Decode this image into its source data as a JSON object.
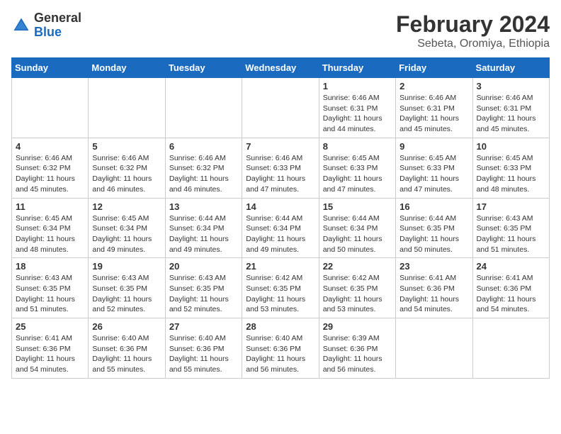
{
  "header": {
    "logo_general": "General",
    "logo_blue": "Blue",
    "month_year": "February 2024",
    "location": "Sebeta, Oromiya, Ethiopia"
  },
  "calendar": {
    "days_of_week": [
      "Sunday",
      "Monday",
      "Tuesday",
      "Wednesday",
      "Thursday",
      "Friday",
      "Saturday"
    ],
    "weeks": [
      [
        {
          "day": "",
          "info": ""
        },
        {
          "day": "",
          "info": ""
        },
        {
          "day": "",
          "info": ""
        },
        {
          "day": "",
          "info": ""
        },
        {
          "day": "1",
          "info": "Sunrise: 6:46 AM\nSunset: 6:31 PM\nDaylight: 11 hours and 44 minutes."
        },
        {
          "day": "2",
          "info": "Sunrise: 6:46 AM\nSunset: 6:31 PM\nDaylight: 11 hours and 45 minutes."
        },
        {
          "day": "3",
          "info": "Sunrise: 6:46 AM\nSunset: 6:31 PM\nDaylight: 11 hours and 45 minutes."
        }
      ],
      [
        {
          "day": "4",
          "info": "Sunrise: 6:46 AM\nSunset: 6:32 PM\nDaylight: 11 hours and 45 minutes."
        },
        {
          "day": "5",
          "info": "Sunrise: 6:46 AM\nSunset: 6:32 PM\nDaylight: 11 hours and 46 minutes."
        },
        {
          "day": "6",
          "info": "Sunrise: 6:46 AM\nSunset: 6:32 PM\nDaylight: 11 hours and 46 minutes."
        },
        {
          "day": "7",
          "info": "Sunrise: 6:46 AM\nSunset: 6:33 PM\nDaylight: 11 hours and 47 minutes."
        },
        {
          "day": "8",
          "info": "Sunrise: 6:45 AM\nSunset: 6:33 PM\nDaylight: 11 hours and 47 minutes."
        },
        {
          "day": "9",
          "info": "Sunrise: 6:45 AM\nSunset: 6:33 PM\nDaylight: 11 hours and 47 minutes."
        },
        {
          "day": "10",
          "info": "Sunrise: 6:45 AM\nSunset: 6:33 PM\nDaylight: 11 hours and 48 minutes."
        }
      ],
      [
        {
          "day": "11",
          "info": "Sunrise: 6:45 AM\nSunset: 6:34 PM\nDaylight: 11 hours and 48 minutes."
        },
        {
          "day": "12",
          "info": "Sunrise: 6:45 AM\nSunset: 6:34 PM\nDaylight: 11 hours and 49 minutes."
        },
        {
          "day": "13",
          "info": "Sunrise: 6:44 AM\nSunset: 6:34 PM\nDaylight: 11 hours and 49 minutes."
        },
        {
          "day": "14",
          "info": "Sunrise: 6:44 AM\nSunset: 6:34 PM\nDaylight: 11 hours and 49 minutes."
        },
        {
          "day": "15",
          "info": "Sunrise: 6:44 AM\nSunset: 6:34 PM\nDaylight: 11 hours and 50 minutes."
        },
        {
          "day": "16",
          "info": "Sunrise: 6:44 AM\nSunset: 6:35 PM\nDaylight: 11 hours and 50 minutes."
        },
        {
          "day": "17",
          "info": "Sunrise: 6:43 AM\nSunset: 6:35 PM\nDaylight: 11 hours and 51 minutes."
        }
      ],
      [
        {
          "day": "18",
          "info": "Sunrise: 6:43 AM\nSunset: 6:35 PM\nDaylight: 11 hours and 51 minutes."
        },
        {
          "day": "19",
          "info": "Sunrise: 6:43 AM\nSunset: 6:35 PM\nDaylight: 11 hours and 52 minutes."
        },
        {
          "day": "20",
          "info": "Sunrise: 6:43 AM\nSunset: 6:35 PM\nDaylight: 11 hours and 52 minutes."
        },
        {
          "day": "21",
          "info": "Sunrise: 6:42 AM\nSunset: 6:35 PM\nDaylight: 11 hours and 53 minutes."
        },
        {
          "day": "22",
          "info": "Sunrise: 6:42 AM\nSunset: 6:35 PM\nDaylight: 11 hours and 53 minutes."
        },
        {
          "day": "23",
          "info": "Sunrise: 6:41 AM\nSunset: 6:36 PM\nDaylight: 11 hours and 54 minutes."
        },
        {
          "day": "24",
          "info": "Sunrise: 6:41 AM\nSunset: 6:36 PM\nDaylight: 11 hours and 54 minutes."
        }
      ],
      [
        {
          "day": "25",
          "info": "Sunrise: 6:41 AM\nSunset: 6:36 PM\nDaylight: 11 hours and 54 minutes."
        },
        {
          "day": "26",
          "info": "Sunrise: 6:40 AM\nSunset: 6:36 PM\nDaylight: 11 hours and 55 minutes."
        },
        {
          "day": "27",
          "info": "Sunrise: 6:40 AM\nSunset: 6:36 PM\nDaylight: 11 hours and 55 minutes."
        },
        {
          "day": "28",
          "info": "Sunrise: 6:40 AM\nSunset: 6:36 PM\nDaylight: 11 hours and 56 minutes."
        },
        {
          "day": "29",
          "info": "Sunrise: 6:39 AM\nSunset: 6:36 PM\nDaylight: 11 hours and 56 minutes."
        },
        {
          "day": "",
          "info": ""
        },
        {
          "day": "",
          "info": ""
        }
      ]
    ]
  }
}
